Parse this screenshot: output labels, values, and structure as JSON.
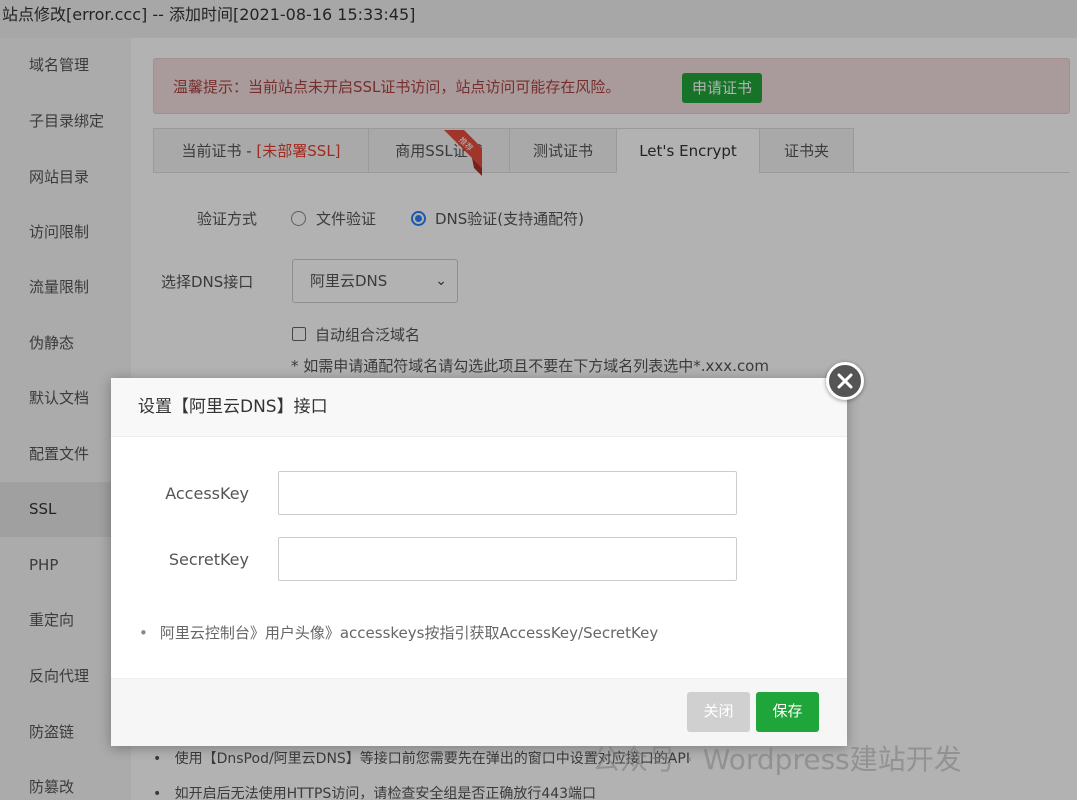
{
  "window": {
    "title": "站点修改[error.ccc] -- 添加时间[2021-08-16 15:33:45]"
  },
  "sidebar": {
    "items": [
      {
        "label": "域名管理"
      },
      {
        "label": "子目录绑定"
      },
      {
        "label": "网站目录"
      },
      {
        "label": "访问限制"
      },
      {
        "label": "流量限制"
      },
      {
        "label": "伪静态"
      },
      {
        "label": "默认文档"
      },
      {
        "label": "配置文件"
      },
      {
        "label": "SSL"
      },
      {
        "label": "PHP"
      },
      {
        "label": "重定向"
      },
      {
        "label": "反向代理"
      },
      {
        "label": "防盗链"
      },
      {
        "label": "防篡改"
      }
    ],
    "active": "SSL"
  },
  "warning": {
    "text": "温馨提示：当前站点未开启SSL证书访问，站点访问可能存在风险。",
    "button": "申请证书"
  },
  "tabs": [
    {
      "label": "当前证书 - ",
      "tag": "[未部署SSL]"
    },
    {
      "label": "商用SSL证书"
    },
    {
      "label": "测试证书"
    },
    {
      "label": "Let's Encrypt"
    },
    {
      "label": "证书夹"
    }
  ],
  "ribbon_text": "推荐",
  "form": {
    "verify_label": "验证方式",
    "verify_option_file": "文件验证",
    "verify_option_dns": "DNS验证(支持通配符)",
    "dns_label": "选择DNS接口",
    "dns_selected": "阿里云DNS",
    "auto_combine": "自动组合泛域名",
    "note": "* 如需申请通配符域名请勾选此项且不要在下方域名列表选中*.xxx.com"
  },
  "bullets": [
    "使用【DnsPod/阿里云DNS】等接口前您需要先在弹出的窗口中设置对应接口的API",
    "如开启后无法使用HTTPS访问，请检查安全组是否正确放行443端口"
  ],
  "modal": {
    "title": "设置【阿里云DNS】接口",
    "fields": [
      {
        "label": "AccessKey",
        "value": ""
      },
      {
        "label": "SecretKey",
        "value": ""
      }
    ],
    "hint": "阿里云控制台》用户头像》accesskeys按指引获取AccessKey/SecretKey",
    "close_button": "关闭",
    "save_button": "保存"
  },
  "watermark": "公众号 · Wordpress建站开发",
  "colors": {
    "accent_green": "#20a53a",
    "warning_bg": "#f2dede",
    "warning_text": "#a94442",
    "radio_blue": "#2f7ef6",
    "tag_red": "#e73d2e"
  },
  "icons": {
    "close": "close-icon",
    "chevron": "chevron-down-icon"
  }
}
